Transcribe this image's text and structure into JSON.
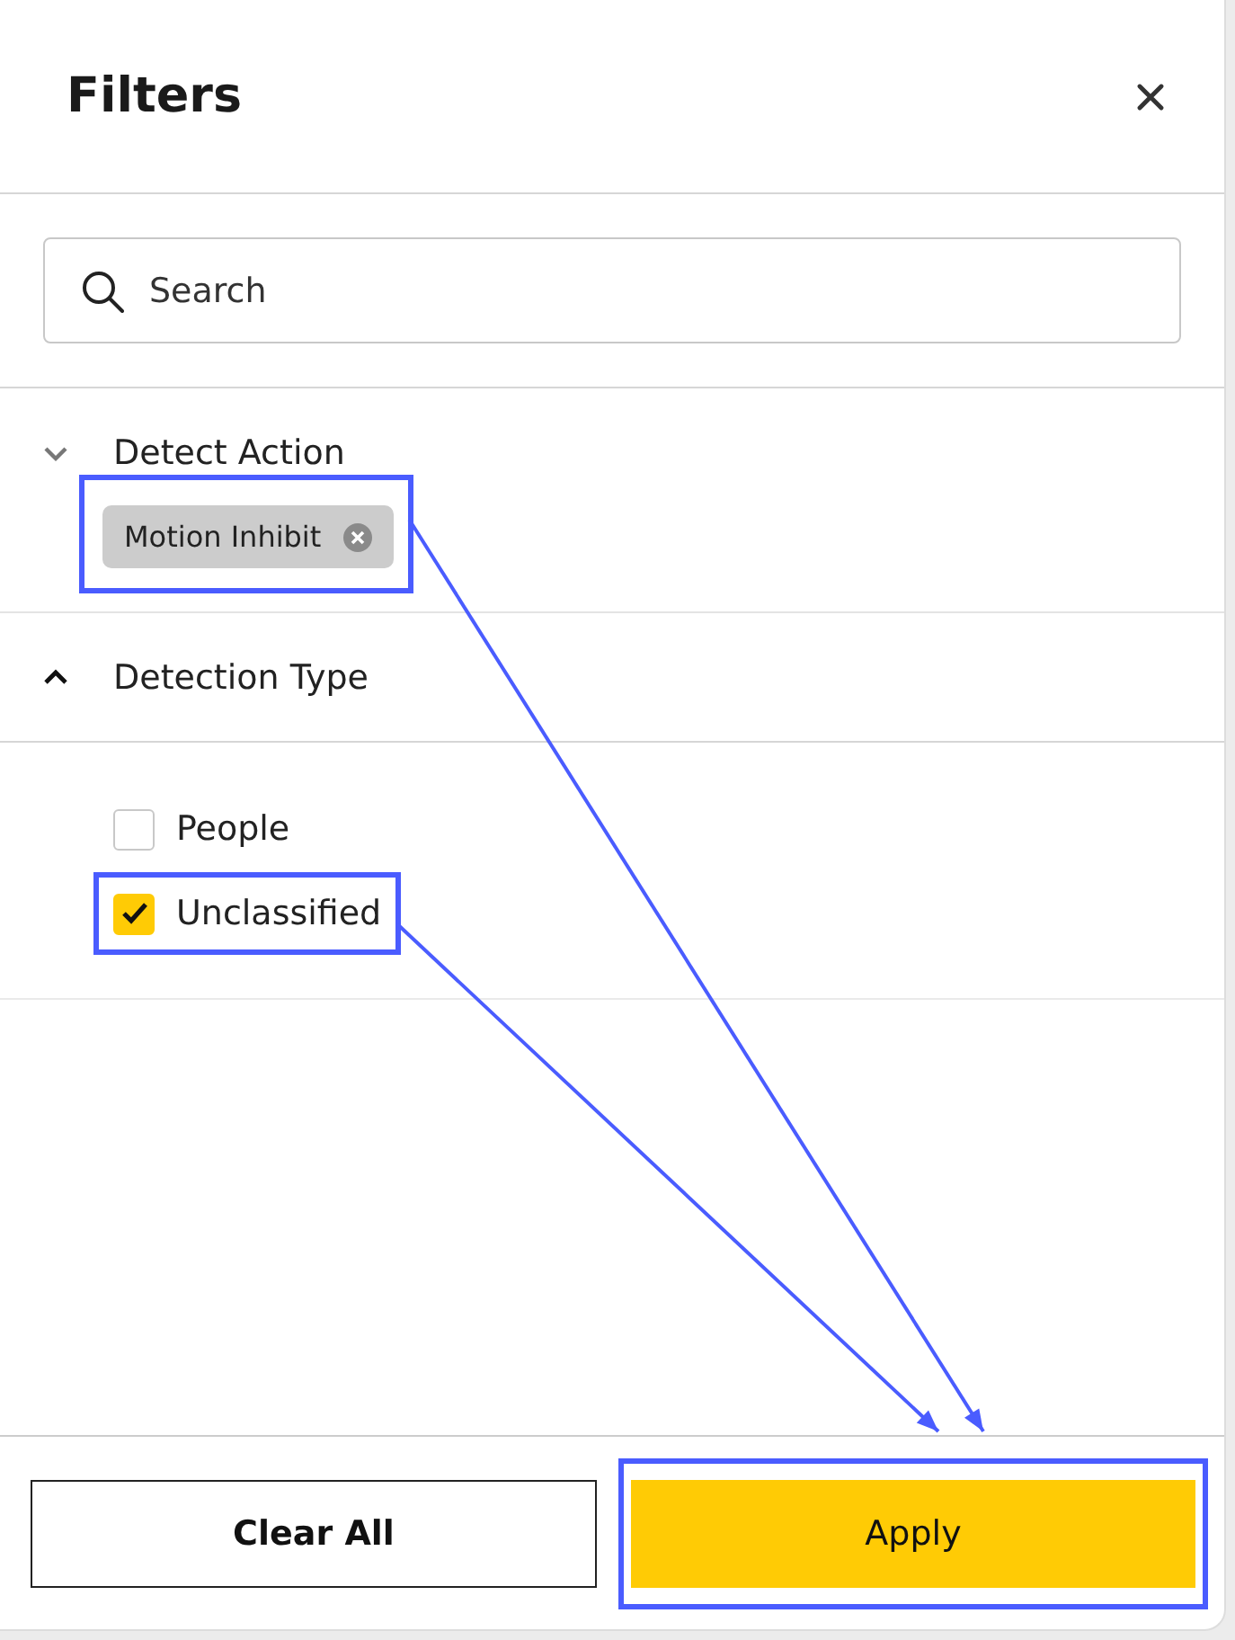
{
  "title": "Filters",
  "search": {
    "placeholder": "Search"
  },
  "sections": [
    {
      "title": "Detect Action",
      "expanded": false,
      "chips": [
        {
          "label": "Motion Inhibit",
          "highlighted": true
        }
      ]
    },
    {
      "title": "Detection Type",
      "expanded": true,
      "options": [
        {
          "label": "People",
          "checked": false,
          "highlighted": false
        },
        {
          "label": "Unclassified",
          "checked": true,
          "highlighted": true
        }
      ]
    }
  ],
  "buttons": [
    {
      "label": "Clear All",
      "kind": "secondary",
      "highlighted": false
    },
    {
      "label": "Apply",
      "kind": "primary",
      "highlighted": true
    }
  ]
}
